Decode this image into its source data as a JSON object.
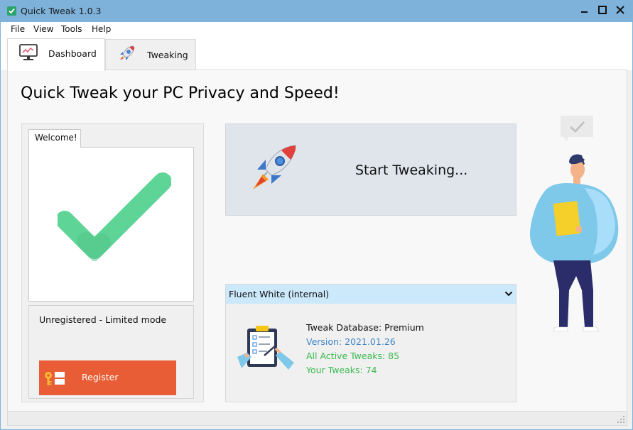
{
  "window": {
    "title": "Quick Tweak 1.0.3",
    "controls": [
      "minimize-icon",
      "maximize-icon",
      "close-icon"
    ]
  },
  "menu": {
    "file": "File",
    "view": "View",
    "tools": "Tools",
    "help": "Help"
  },
  "tabs": {
    "dashboard": {
      "label": "Dashboard",
      "icon": "monitor-chart-icon",
      "active": true
    },
    "tweaking": {
      "label": "Tweaking",
      "icon": "rocket-icon",
      "active": false
    }
  },
  "main": {
    "title": "Quick Tweak your PC Privacy and Speed!",
    "welcome_tab": "Welcome!",
    "registration_status": "Unregistered - Limited mode",
    "register_label": "Register",
    "start_label": "Start Tweaking...",
    "theme": "Fluent White (internal)",
    "database": {
      "title": "Tweak Database: Premium",
      "version": "Version: 2021.01.26",
      "active": "All Active Tweaks: 85",
      "yours": "Your Tweaks: 74"
    }
  },
  "colors": {
    "titlebar": "#7eb2da",
    "check": "#5ed596",
    "register": "#e85d35",
    "start_bg": "#dfe5eb",
    "theme_header": "#cce8fb",
    "version": "#3d86c6",
    "counts": "#3cb94e"
  }
}
